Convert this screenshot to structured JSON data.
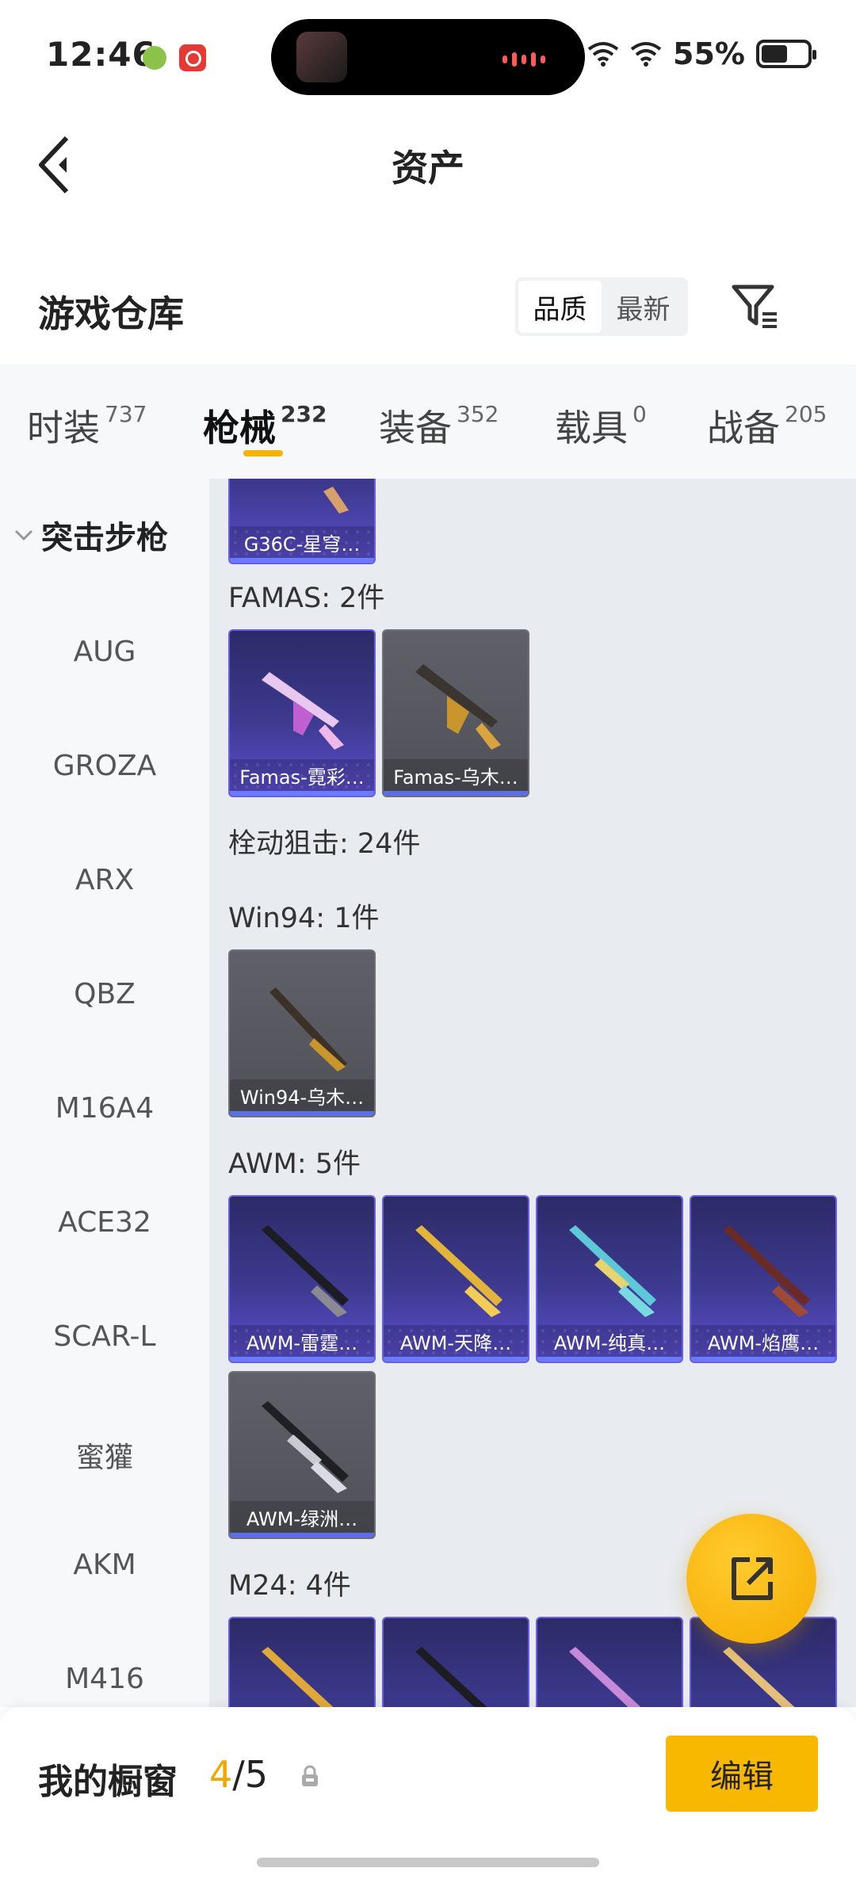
{
  "status_bar": {
    "time": "12:46",
    "battery": "55%"
  },
  "header": {
    "title": "资产"
  },
  "warehouse": {
    "title": "游戏仓库",
    "sort_options": [
      "品质",
      "最新"
    ]
  },
  "tabs": [
    {
      "label": "时装",
      "count": "737"
    },
    {
      "label": "枪械",
      "count": "232"
    },
    {
      "label": "装备",
      "count": "352"
    },
    {
      "label": "载具",
      "count": "0"
    },
    {
      "label": "战备",
      "count": "205"
    }
  ],
  "sidebar": {
    "category": "突击步枪",
    "items": [
      "AUG",
      "GROZA",
      "ARX",
      "QBZ",
      "M16A4",
      "ACE32",
      "SCAR-L",
      "蜜獾",
      "AKM",
      "M416"
    ]
  },
  "content": {
    "top_card": "G36C-星穹…",
    "sections": [
      {
        "label": "FAMAS: 2件",
        "cards": [
          "Famas-霓彩…",
          "Famas-乌木…"
        ]
      },
      {
        "label": "栓动狙击: 24件"
      },
      {
        "label": "Win94: 1件",
        "cards": [
          "Win94-乌木…"
        ]
      },
      {
        "label": "AWM: 5件",
        "cards": [
          "AWM-雷霆…",
          "AWM-天降…",
          "AWM-纯真…",
          "AWM-焰鹰…",
          "AWM-绿洲…"
        ]
      },
      {
        "label": "M24: 4件"
      }
    ]
  },
  "bottom_bar": {
    "showcase_label": "我的橱窗",
    "current": "4",
    "separator": "/",
    "total": "5",
    "edit_label": "编辑"
  },
  "colors": {
    "accent": "#f9b800",
    "purple_card": "#3d3a90",
    "gray_card": "#55565e"
  },
  "icons": {
    "back": "back-arrow-icon",
    "filter": "filter-icon",
    "share": "share-external-icon",
    "lock": "lock-icon"
  }
}
